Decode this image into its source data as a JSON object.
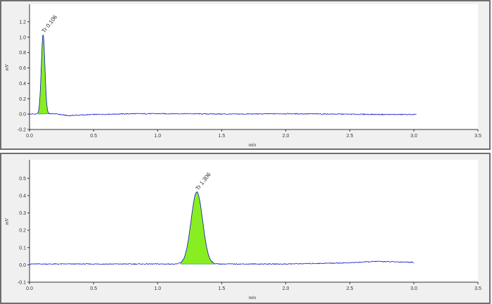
{
  "colors": {
    "trace": "#1a1acc",
    "peak_fill": "#88ee22",
    "peak_fill_stroke": "#2a9a2a",
    "axis": "#333333",
    "plot_bg": "#ffffff",
    "panel_bg": "#f0f0f0"
  },
  "chart_data": [
    {
      "type": "line",
      "xlabel": "min",
      "ylabel": "mV",
      "xlim": [
        0,
        3.5
      ],
      "ylim": [
        -0.2,
        1.3
      ],
      "x_ticks": [
        "0.0",
        "0.5",
        "1.0",
        "1.5",
        "2.0",
        "2.5",
        "3.0",
        "3.5"
      ],
      "y_ticks": [
        "-0.2",
        "0.0",
        "0.2",
        "0.4",
        "0.6",
        "0.8",
        "1.0",
        "1.2"
      ],
      "grid": false,
      "trace_end": 3.02,
      "baseline": [
        [
          0.0,
          0.0
        ],
        [
          0.2,
          0.005
        ],
        [
          0.3,
          -0.02
        ],
        [
          0.5,
          -0.005
        ],
        [
          0.8,
          0.005
        ],
        [
          1.2,
          0.005
        ],
        [
          1.6,
          0.0
        ],
        [
          2.0,
          0.005
        ],
        [
          2.4,
          0.0
        ],
        [
          2.8,
          -0.005
        ],
        [
          3.02,
          -0.005
        ]
      ],
      "peaks": [
        {
          "label": "Tr 0.106",
          "rt": 0.106,
          "height": 1.03,
          "sigma": 0.014,
          "start": 0.07,
          "end": 0.16
        }
      ]
    },
    {
      "type": "line",
      "xlabel": "min",
      "ylabel": "mV",
      "xlim": [
        0,
        3.5
      ],
      "ylim": [
        -0.1,
        0.55
      ],
      "x_ticks": [
        "0.0",
        "0.5",
        "1.0",
        "1.5",
        "2.0",
        "2.5",
        "3.0",
        "3.5"
      ],
      "y_ticks": [
        "-0.1",
        "0.0",
        "0.1",
        "0.2",
        "0.3",
        "0.4",
        "0.5"
      ],
      "grid": false,
      "trace_end": 3.0,
      "baseline": [
        [
          0.0,
          0.005
        ],
        [
          0.5,
          0.005
        ],
        [
          1.0,
          0.005
        ],
        [
          1.5,
          0.005
        ],
        [
          2.0,
          0.005
        ],
        [
          2.5,
          0.012
        ],
        [
          2.7,
          0.02
        ],
        [
          3.0,
          0.015
        ]
      ],
      "peaks": [
        {
          "label": "Tr 1.306",
          "rt": 1.306,
          "height": 0.415,
          "sigma": 0.045,
          "start": 1.18,
          "end": 1.44
        }
      ]
    }
  ]
}
